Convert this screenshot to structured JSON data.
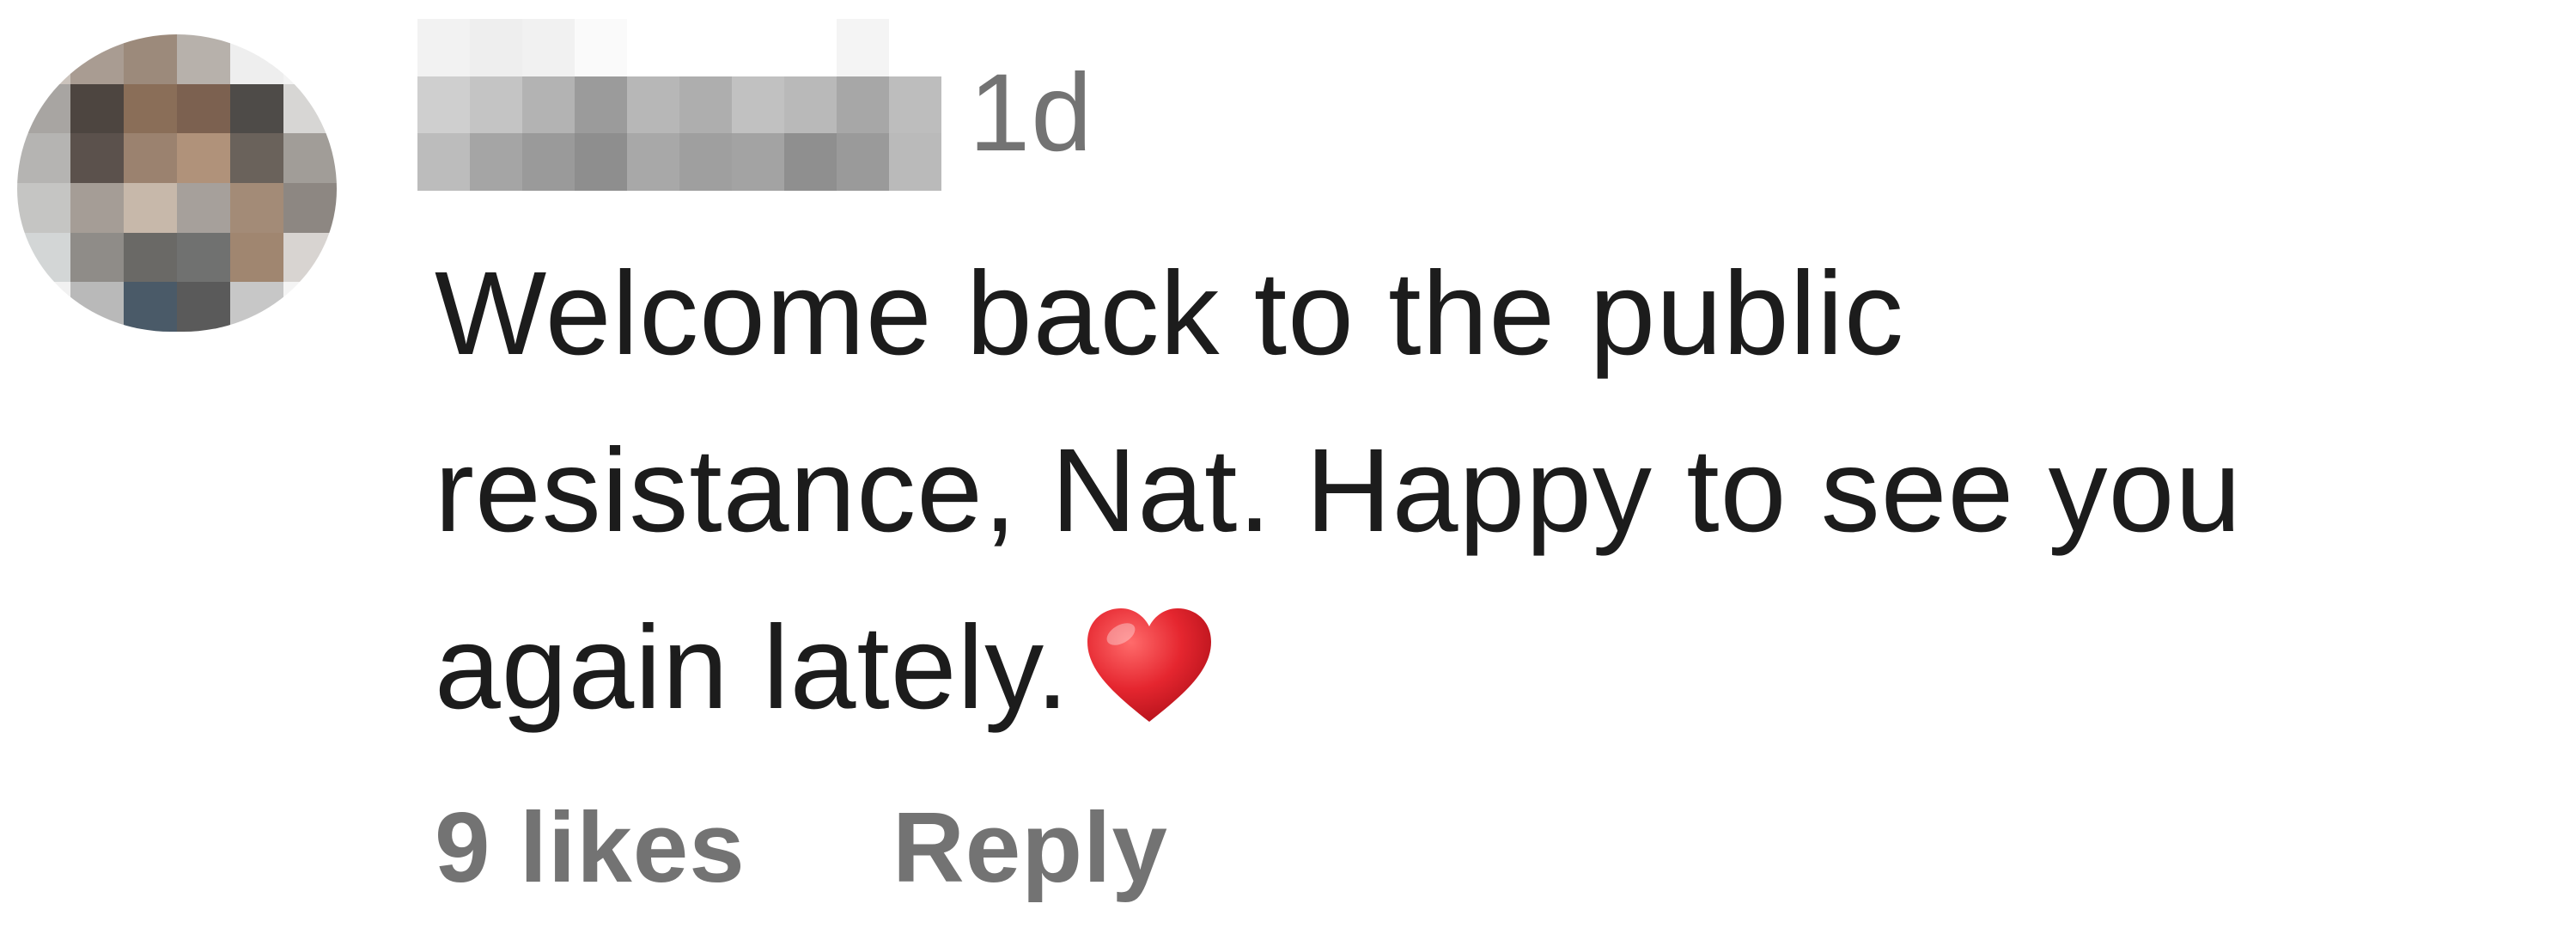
{
  "comment": {
    "timestamp": "1d",
    "text": "Welcome back to the public resistance, Nat. Happy to see you again lately.",
    "heart_icon": "red-heart-emoji",
    "likes_label": "9 likes",
    "reply_label": "Reply"
  },
  "colors": {
    "meta_text": "#737373",
    "body_text": "#1c1c1c",
    "heart": "#e0202c",
    "background": "#ffffff"
  }
}
